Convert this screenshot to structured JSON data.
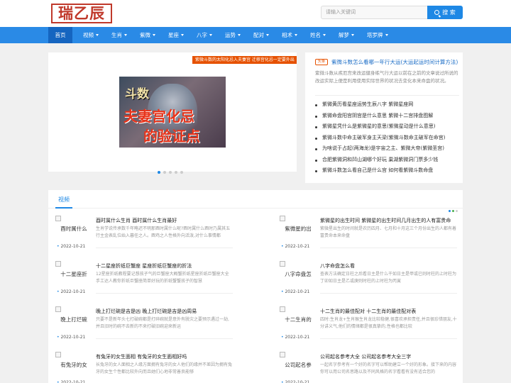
{
  "header": {
    "logo_text": "瑞乙辰",
    "search_placeholder": "请输入关键词",
    "search_label": "搜 索"
  },
  "nav": {
    "items": [
      {
        "label": "首页",
        "dropdown": false
      },
      {
        "label": "视频",
        "dropdown": true
      },
      {
        "label": "生肖",
        "dropdown": true
      },
      {
        "label": "紫微",
        "dropdown": true
      },
      {
        "label": "星座",
        "dropdown": true
      },
      {
        "label": "八字",
        "dropdown": true
      },
      {
        "label": "运势",
        "dropdown": true
      },
      {
        "label": "配对",
        "dropdown": true
      },
      {
        "label": "相术",
        "dropdown": true
      },
      {
        "label": "姓名",
        "dropdown": true
      },
      {
        "label": "解梦",
        "dropdown": true
      },
      {
        "label": "塔罗牌",
        "dropdown": true
      }
    ]
  },
  "carousel": {
    "caption": "紫微斗数的太阳化忌入夫妻宫 迁移宫化忌一定要外出",
    "image_text": [
      "斗数",
      "夫妻宫化忌",
      "的验证点"
    ],
    "slide_count": 5,
    "active_slide": 1
  },
  "topnews": {
    "tag": "头条",
    "title": "紫微斗数怎么看哪一年行大运(大运起运时间计算方法)",
    "desc": "紫微斗数从疾厄宫来改运健身练气行大运以前在之前的文章说过所说的改运实际上便是利用使用实际世界的状况去变化本来命盘的状况。",
    "list": [
      "紫微黄历看星座运势生辰八字 紫微星座网",
      "紫微命盘阳宫阴宫是什么意思 紫微十二宫排盘图解",
      "紫微星凭什么是紫微星的意思(紫微星动是什么意思)",
      "紫微斗数中命主破军身主天梁(紫微斗数命主破军在命宫)",
      "为啥说于占起(两海龙)是宇宙之主、紫微大帝(紫微圣宫)",
      "合肥紫微洞和凹山湖哪个好玩 巢湖紫微洞门票多少钱",
      "紫微斗数怎么看自己是什么宫 如何看紫微斗数命盘"
    ]
  },
  "video_section": {
    "title": "视频",
    "dot_colors": [
      "#1e88e5",
      "#4caf50",
      "#cfcfcf"
    ],
    "items": [
      {
        "thumb": "酉时属什么",
        "title": "酉时属什么生肖 酉时属什么生肖最好",
        "desc": "生肖学说传承数千年略迟不明那酉时属什么呢?酉时属什么酉时乃属其五行主金表乱位始入暮任之人。酉鸡之人性格外向活泼,对什么事情都",
        "date": "2022-10-21"
      },
      {
        "thumb": "紫微星的出",
        "title": "紫微星的出生时间 紫微星的出生时间几月出生的人有富贵命",
        "desc": "紫微星出生的时间就是农历四月、七月和十月这三个月份出生的人都有着富贵命本来命盘",
        "date": "2022-10-21"
      },
      {
        "thumb": "十二星座折",
        "title": "十二星座折纸巨蟹座 星座折纸巨蟹座的折法",
        "desc": "12星座折纸教程要记想孩子气的巨蟹座大概蟹折纸星座折纸巨蟹座大全手工达人教你折纸巨蟹座简单好玩的折纸蟹蟹孩子的智慧",
        "date": "2022-10-21"
      },
      {
        "thumb": "八字命盘怎",
        "title": "八字命盘怎么看",
        "desc": "查表方法确定日柱之后看日主是什么干如日主是甲或已则时柱的上时柱为丁卯如日主是乙或庚则时柱的上时柱为丙寅",
        "date": "2022-10-21"
      },
      {
        "thumb": "晚上打烂碗",
        "title": "晚上打烂碗是吉是凶 晚上打烂碗是吉是凶周易",
        "desc": "只要不是新年头七打破碗都是打碎碗就是意外有脱灾之要预示遇过一劫,并且旧时的碗不去新的不来打破旧碗迎来新运",
        "date": "2022-10-21"
      },
      {
        "thumb": "十二生肖的",
        "title": "十二生肖的最佳配对 十二生肖的最佳配对表",
        "desc": "四时:生肖龙+生肖猴生肖龙比较稳健,很喜欢承担责任,并且很珍惜朋友,十分讲义气,他们的情绪都是很真挚的,性格也都比较",
        "date": "2022-10-21"
      },
      {
        "thumb": "有兔牙的女",
        "title": "有兔牙的女生面相 有兔牙的女生面相好吗",
        "desc": "长兔牙的女人面相之人缘方面拥有兔牙的女人他们的缘并不差因为拥有兔牙的女生个性都比较外向而且她们心地非常善良能够",
        "date": "2022-10-21"
      },
      {
        "thumb": "公司起名参",
        "title": "公司起名参考大全 公司起名参考大全三字",
        "desc": "一起名字参考有一个好的名字可以帮助建立一个好的形象。接下来的内容你可以用公司名思路以及不同风格的名字看看有没有适合您的",
        "date": "2022-10-21"
      }
    ]
  }
}
